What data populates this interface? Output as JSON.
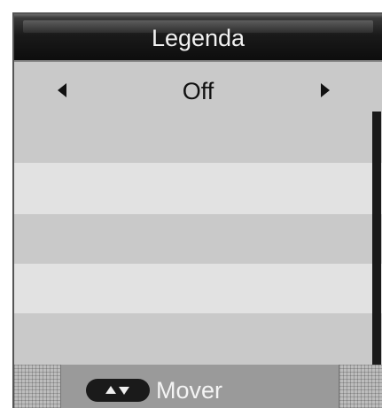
{
  "header": {
    "title": "Legenda"
  },
  "selector": {
    "value": "Off",
    "left_icon": "arrow-left-icon",
    "right_icon": "arrow-right-icon"
  },
  "footer": {
    "hint_icon": "up-down-arrows-icon",
    "hint_label": "Mover"
  },
  "colors": {
    "panel": "#c9c9c9",
    "row_light": "#e2e2e2",
    "title_bar": "#1a1a1a",
    "text_dark": "#111111",
    "text_light": "#f2f2f2"
  }
}
